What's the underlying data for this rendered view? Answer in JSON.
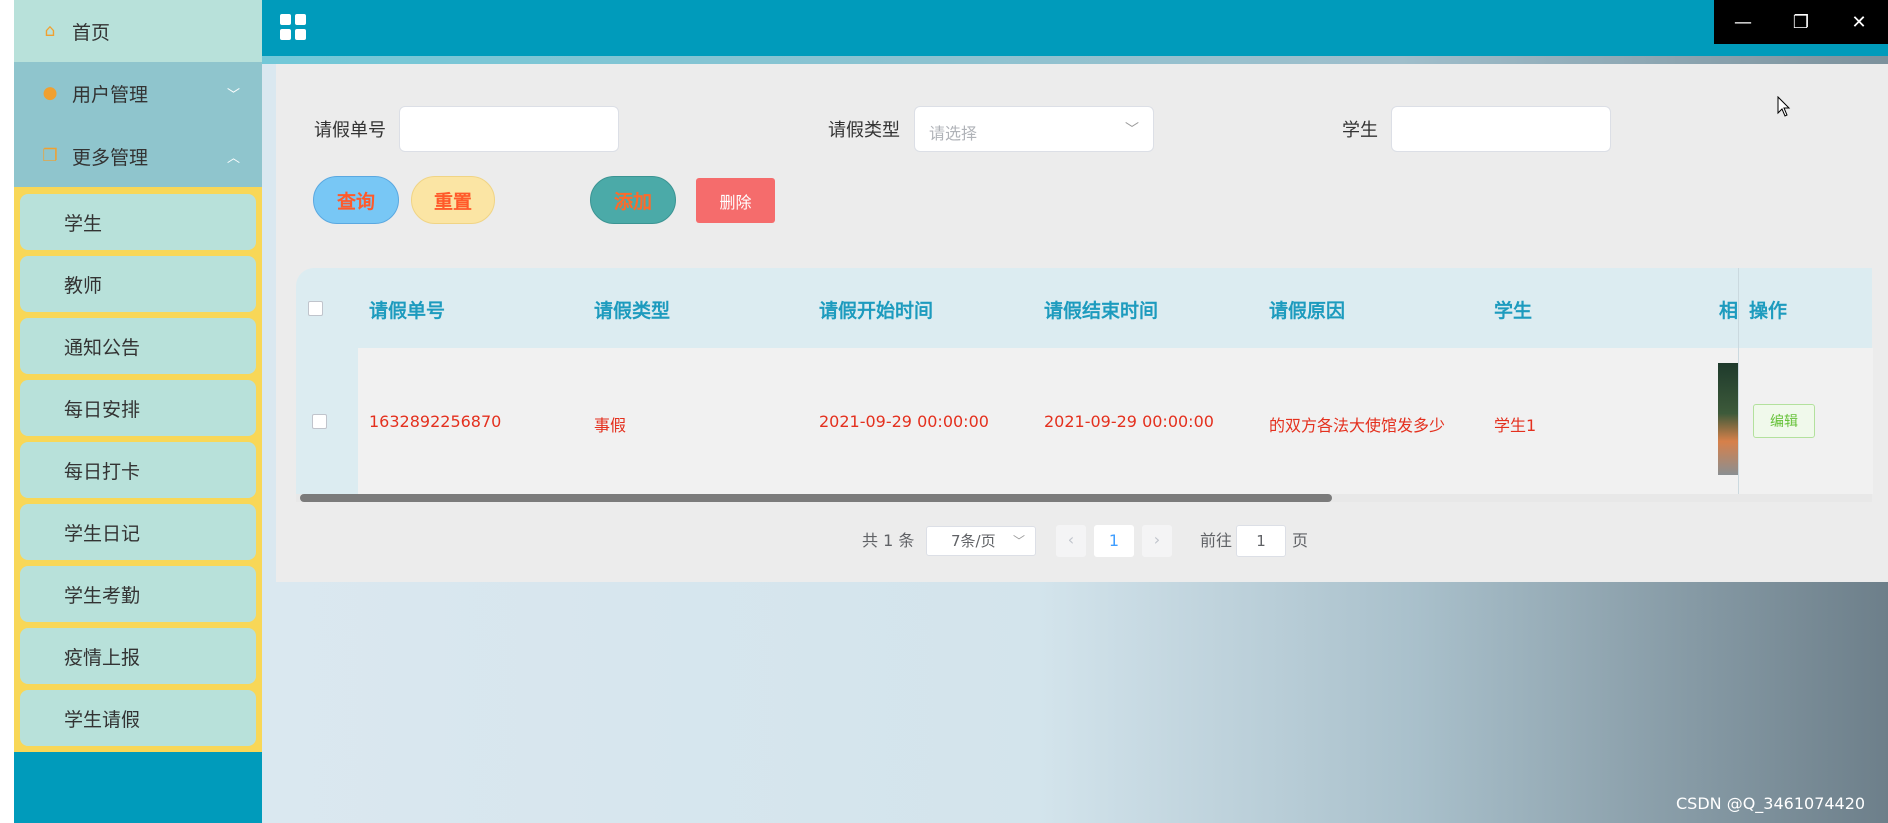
{
  "sidebar": {
    "home_label": "首页",
    "user_mgmt_label": "用户管理",
    "more_mgmt_label": "更多管理",
    "sub_items": [
      {
        "label": "学生"
      },
      {
        "label": "教师"
      },
      {
        "label": "通知公告"
      },
      {
        "label": "每日安排"
      },
      {
        "label": "每日打卡"
      },
      {
        "label": "学生日记"
      },
      {
        "label": "学生考勤"
      },
      {
        "label": "疫情上报"
      },
      {
        "label": "学生请假"
      }
    ]
  },
  "icons": {
    "home": "home-icon",
    "user": "user-icon",
    "more": "copy-icon",
    "menu": "grid-icon"
  },
  "filters": {
    "leave_no_label": "请假单号",
    "leave_no_value": "",
    "leave_type_label": "请假类型",
    "leave_type_placeholder": "请选择",
    "student_label": "学生",
    "student_value": ""
  },
  "buttons": {
    "query": "查询",
    "reset": "重置",
    "add": "添加",
    "delete": "删除",
    "edit": "编辑"
  },
  "table": {
    "headers": [
      "请假单号",
      "请假类型",
      "请假开始时间",
      "请假结束时间",
      "请假原因",
      "学生",
      "相",
      "操作"
    ],
    "rows": [
      {
        "leave_no": "1632892256870",
        "leave_type": "事假",
        "start_time": "2021-09-29 00:00:00",
        "end_time": "2021-09-29 00:00:00",
        "reason": "的双方各法大使馆发多少",
        "student": "学生1"
      }
    ]
  },
  "pagination": {
    "total": "共 1 条",
    "page_size": "7条/页",
    "current_page": "1",
    "goto_prefix": "前往",
    "goto_value": "1",
    "goto_suffix": "页"
  },
  "watermark": "CSDN @Q_3461074420",
  "colors": {
    "sidebar": "#009bbb",
    "submenu_bg": "#f8d757",
    "item_bg": "#b8e1da",
    "header_text": "#1d9bbe",
    "row_text": "#e4301e"
  }
}
